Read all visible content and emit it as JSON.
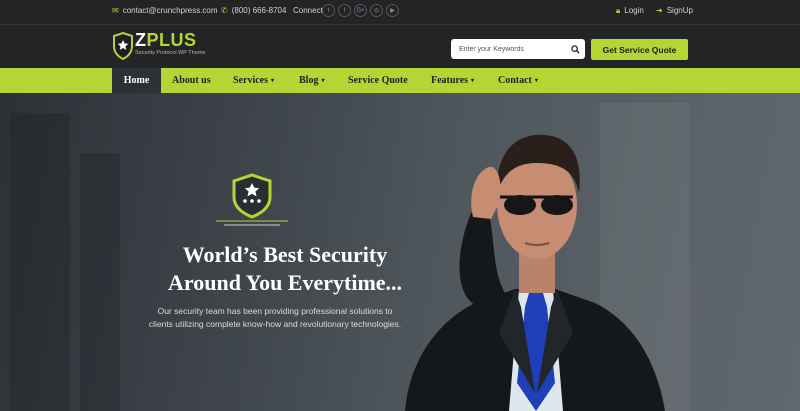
{
  "topbar": {
    "email": "contact@crunchpress.com",
    "phone": "(800) 666-8704",
    "connect_label": "Connect",
    "social": [
      "twitter",
      "facebook",
      "google-plus",
      "instagram",
      "youtube"
    ],
    "social_glyphs": [
      "t",
      "f",
      "G+",
      "◎",
      "▶"
    ],
    "login": "Login",
    "signup": "SignUp"
  },
  "header": {
    "logo_z": "Z",
    "logo_plus": "PLUS",
    "logo_tagline": "Security Protocol WP Theme",
    "search_placeholder": "Enter your Keywords",
    "quote_button": "Get Service Quote"
  },
  "nav": {
    "items": [
      {
        "label": "Home",
        "active": true
      },
      {
        "label": "About us"
      },
      {
        "label": "Services",
        "dropdown": true
      },
      {
        "label": "Blog",
        "dropdown": true
      },
      {
        "label": "Service Quote"
      },
      {
        "label": "Features",
        "dropdown": true
      },
      {
        "label": "Contact",
        "dropdown": true
      }
    ],
    "caret": "▾"
  },
  "hero": {
    "title_line1": "World’s Best Security",
    "title_line2": "Around You Everytime...",
    "subtitle_line1": "Our security team has been providing professional solutions to",
    "subtitle_line2": "clients utilizing complete know-how and revolutionary technologies."
  },
  "colors": {
    "accent": "#b6d433",
    "dark": "#222426",
    "nav_active": "#2e3134"
  }
}
